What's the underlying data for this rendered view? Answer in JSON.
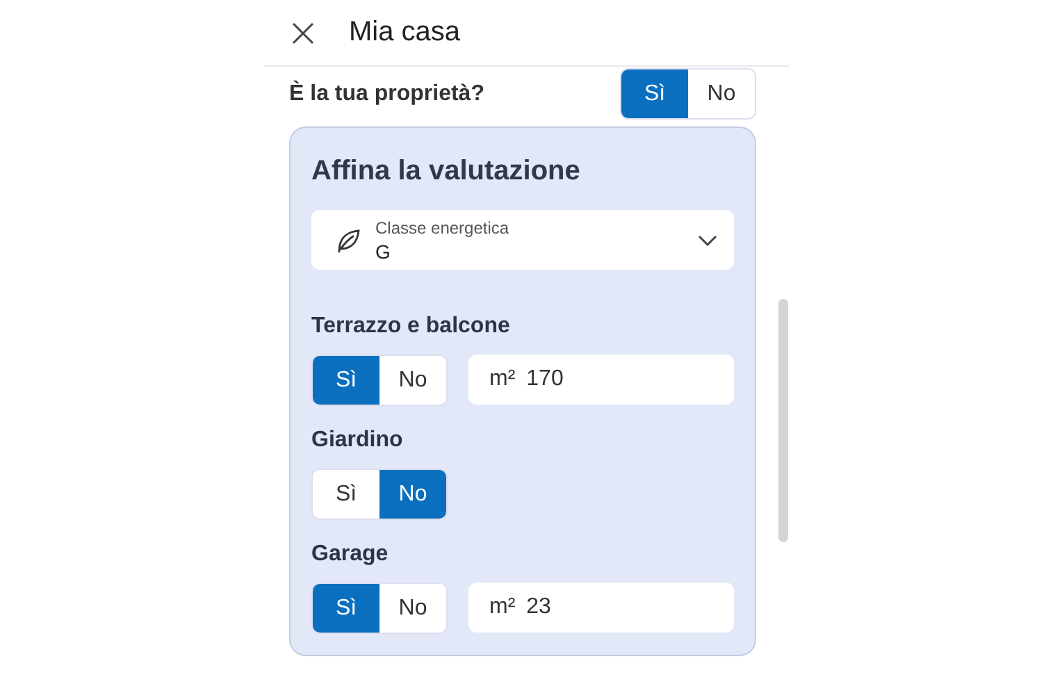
{
  "header": {
    "title": "Mia casa"
  },
  "question": {
    "label": "È la tua proprietà?",
    "options": [
      {
        "label": "Sì",
        "selected": true
      },
      {
        "label": "No",
        "selected": false
      }
    ]
  },
  "card": {
    "title": "Affina la valutazione",
    "select": {
      "label": "Classe energetica",
      "value": "G"
    },
    "features": [
      {
        "label": "Terrazzo e balcone",
        "options": [
          {
            "label": "Sì",
            "selected": true
          },
          {
            "label": "No",
            "selected": false
          }
        ],
        "area": {
          "unit": "m²",
          "value": "170"
        }
      },
      {
        "label": "Giardino",
        "options": [
          {
            "label": "Sì",
            "selected": false
          },
          {
            "label": "No",
            "selected": true
          }
        ]
      },
      {
        "label": "Garage",
        "options": [
          {
            "label": "Sì",
            "selected": true
          },
          {
            "label": "No",
            "selected": false
          }
        ],
        "area": {
          "unit": "m²",
          "value": "23"
        }
      }
    ]
  }
}
